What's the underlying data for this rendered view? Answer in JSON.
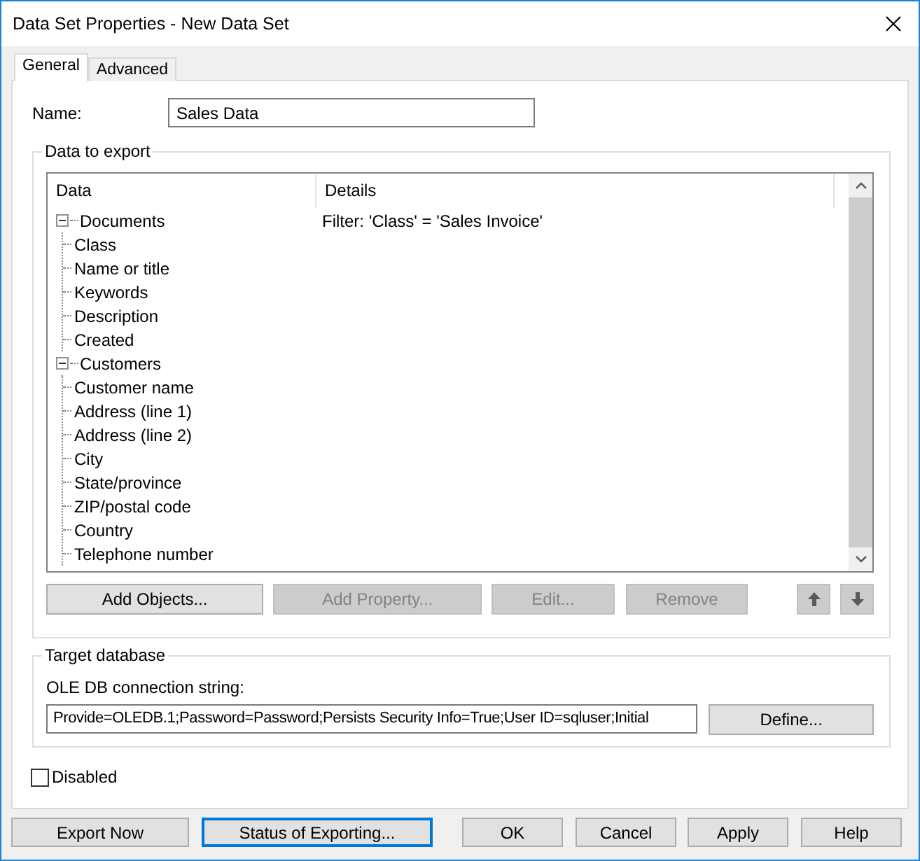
{
  "window": {
    "title": "Data Set Properties - New Data Set"
  },
  "tabs": [
    {
      "label": "General",
      "selected": true
    },
    {
      "label": "Advanced",
      "selected": false
    }
  ],
  "name_field": {
    "label": "Name:",
    "value": "Sales Data"
  },
  "data_to_export": {
    "title": "Data to export",
    "columns": [
      "Data",
      "Details"
    ],
    "tree": [
      {
        "label": "Documents",
        "details": "Filter: 'Class' = 'Sales Invoice'",
        "expanded": true,
        "children": [
          {
            "label": "Class"
          },
          {
            "label": "Name or title"
          },
          {
            "label": "Keywords"
          },
          {
            "label": "Description"
          },
          {
            "label": "Created"
          }
        ]
      },
      {
        "label": "Customers",
        "expanded": true,
        "children": [
          {
            "label": "Customer name"
          },
          {
            "label": "Address (line 1)"
          },
          {
            "label": "Address (line 2)"
          },
          {
            "label": "City"
          },
          {
            "label": "State/province"
          },
          {
            "label": "ZIP/postal code"
          },
          {
            "label": "Country"
          },
          {
            "label": "Telephone number"
          }
        ]
      }
    ],
    "buttons": [
      {
        "label": "Add Objects...",
        "disabled": false
      },
      {
        "label": "Add Property...",
        "disabled": true
      },
      {
        "label": "Edit...",
        "disabled": true
      },
      {
        "label": "Remove",
        "disabled": true
      }
    ]
  },
  "target_database": {
    "title": "Target database",
    "label": "OLE DB connection string:",
    "value": "Provide=OLEDB.1;Password=Password;Persists Security Info=True;User ID=sqluser;Initial",
    "button": "Define..."
  },
  "disabled_checkbox": {
    "label": "Disabled",
    "checked": false
  },
  "footer_buttons": [
    {
      "label": "Export Now",
      "focused": false
    },
    {
      "label": "Status of Exporting...",
      "focused": true
    },
    {
      "label": "OK",
      "focused": false
    },
    {
      "label": "Cancel",
      "focused": false
    },
    {
      "label": "Apply",
      "focused": false
    },
    {
      "label": "Help",
      "focused": false
    }
  ]
}
